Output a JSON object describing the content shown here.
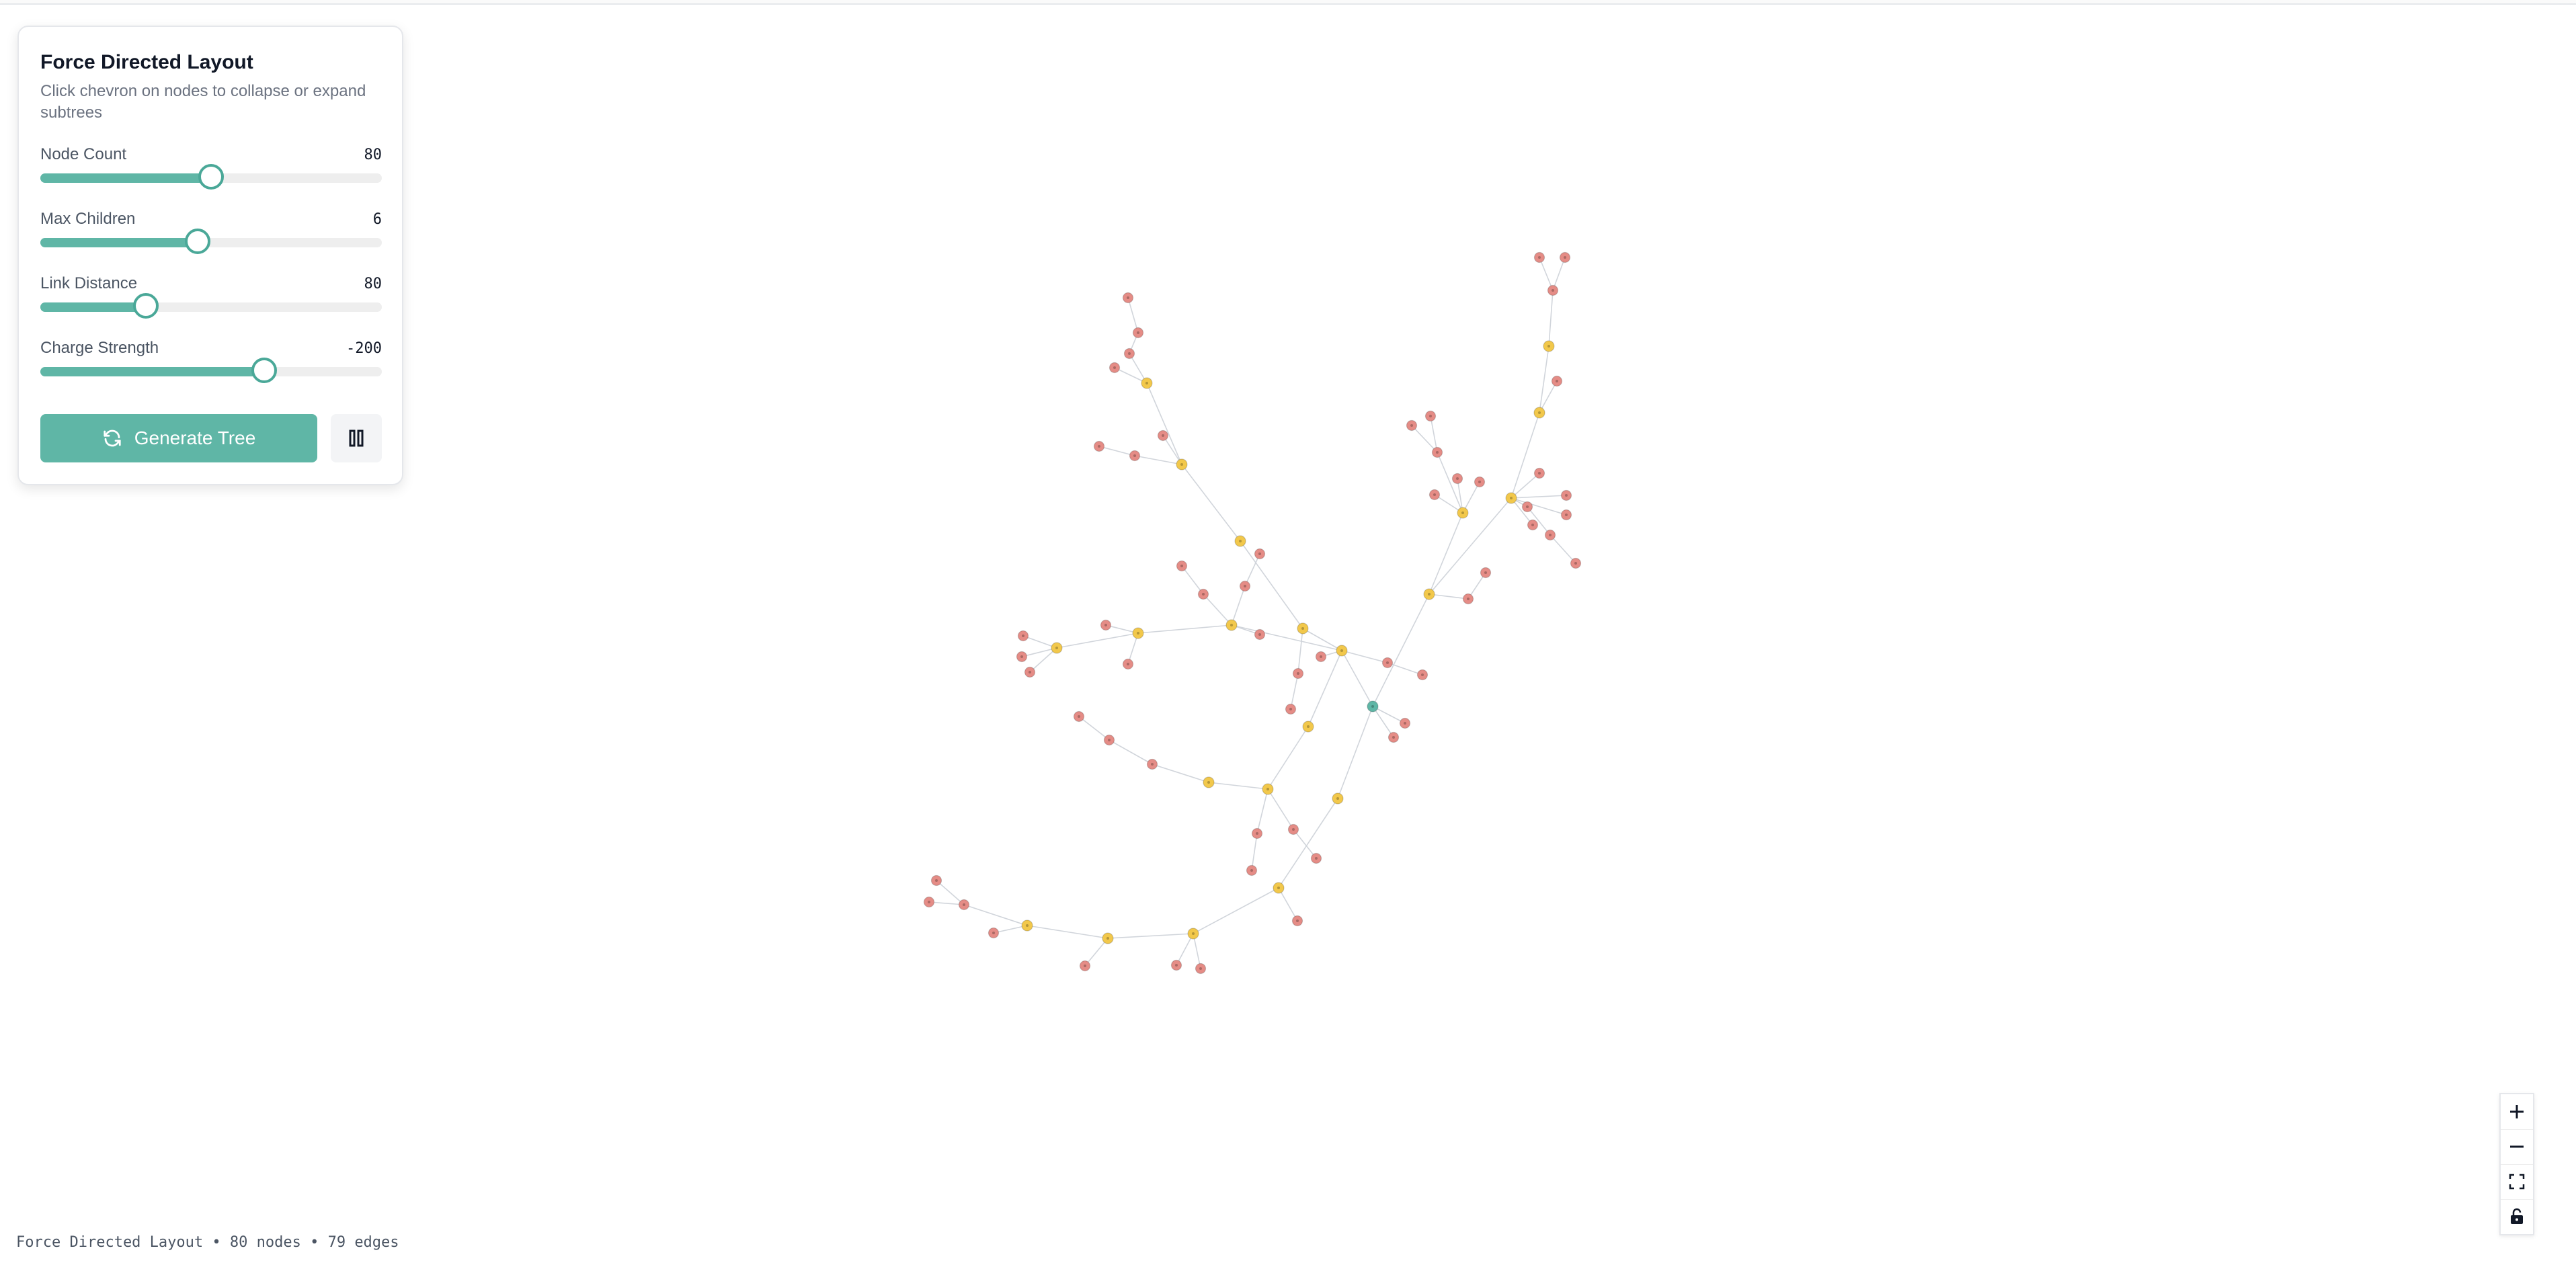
{
  "panel": {
    "title": "Force Directed Layout",
    "subtitle": "Click chevron on nodes to collapse or expand subtrees",
    "controls": [
      {
        "label": "Node Count",
        "value": "80",
        "fraction": 0.5
      },
      {
        "label": "Max Children",
        "value": "6",
        "fraction": 0.46
      },
      {
        "label": "Link Distance",
        "value": "80",
        "fraction": 0.31
      },
      {
        "label": "Charge Strength",
        "value": "-200",
        "fraction": 0.655
      }
    ],
    "generate_label": "Generate Tree",
    "generate_icon": "refresh-icon",
    "pause_icon": "pause-icon"
  },
  "zoom": {
    "zoom_in_icon": "plus-icon",
    "zoom_out_icon": "minus-icon",
    "fit_icon": "fit-view-icon",
    "lock_icon": "lock-icon"
  },
  "status": "Force Directed Layout • 80 nodes • 79 edges",
  "colors": {
    "accent": "#5fb6a6",
    "root_node": "#5fb6a6",
    "branch_node": "#f2c84b",
    "leaf_node": "#e58c86",
    "edge": "#d1d5db"
  }
}
